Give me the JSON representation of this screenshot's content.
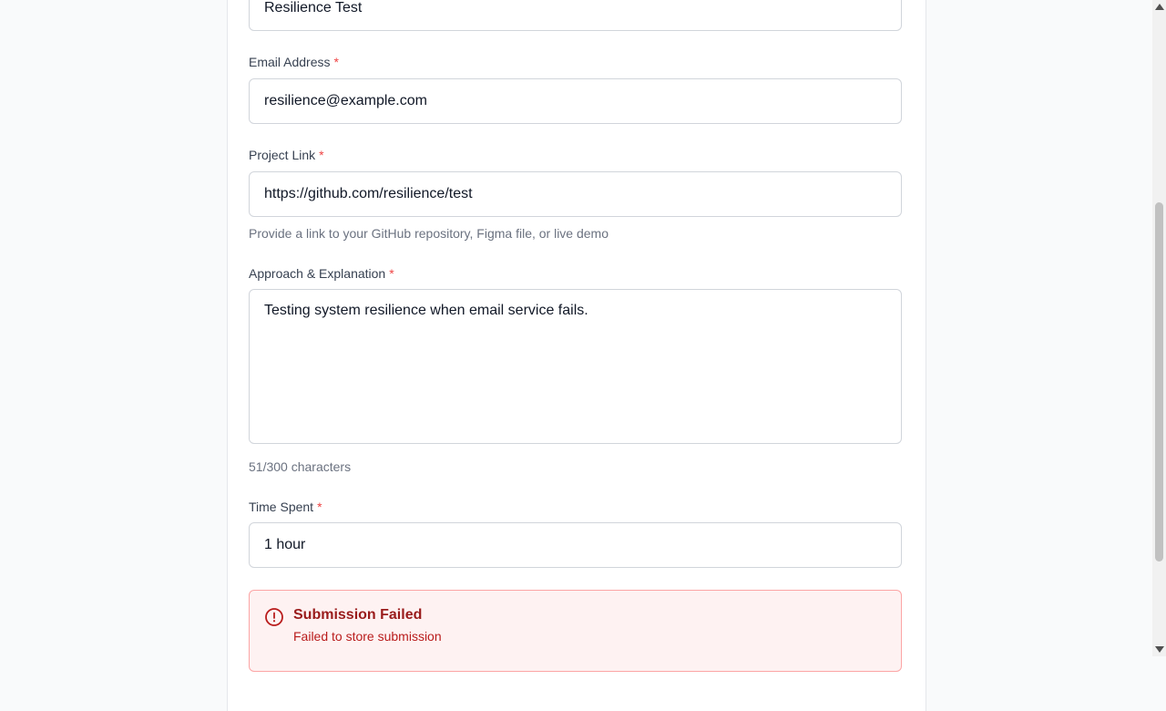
{
  "form": {
    "name_value": "Resilience Test",
    "email": {
      "label": "Email Address",
      "required": "*",
      "value": "resilience@example.com"
    },
    "project_link": {
      "label": "Project Link",
      "required": "*",
      "value": "https://github.com/resilience/test",
      "hint": "Provide a link to your GitHub repository, Figma file, or live demo"
    },
    "approach": {
      "label": "Approach & Explanation",
      "required": "*",
      "value": "Testing system resilience when email service fails.",
      "counter": "51/300 characters"
    },
    "time_spent": {
      "label": "Time Spent",
      "required": "*",
      "value": "1 hour"
    }
  },
  "alert": {
    "icon": "alert-circle-icon",
    "title": "Submission Failed",
    "message": "Failed to store submission",
    "color": "#991b1b"
  }
}
